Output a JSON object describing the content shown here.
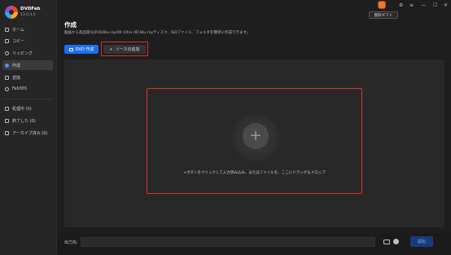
{
  "app": {
    "brand": "DVDFab",
    "version": "13.0.4.5"
  },
  "window": {
    "minimize": "—",
    "maximize": "☐",
    "close": "✕",
    "menu": "≡",
    "settings": "⚙"
  },
  "header": {
    "gift_label": "無料ギフト"
  },
  "sidebar": {
    "items": [
      {
        "label": "ホーム"
      },
      {
        "label": "コピー"
      },
      {
        "label": "リッピング"
      },
      {
        "label": "作成"
      },
      {
        "label": "変換"
      },
      {
        "label": "Fab365"
      }
    ],
    "queue": [
      {
        "label": "処理中 (0)"
      },
      {
        "label": "終了した (0)"
      },
      {
        "label": "アーカイブ済み (0)"
      }
    ]
  },
  "main": {
    "title": "作成",
    "description": "動画から高品質なDVD/Blu-ray/4K Ultra HD Blu-rayディスク、ISOファイル、フォルダを簡単に作成できます。",
    "dvd_button": "DVD 作成",
    "add_source_button": "ソースの追加",
    "add_source_icon": "+",
    "plus_symbol": "+",
    "drop_hint": "+ボタンをクリックして入力済み込み、またはファイルを、ここにドラッグ＆ドロップ"
  },
  "footer": {
    "output_label": "出力先:",
    "output_value": "",
    "start_button": "開始"
  },
  "colors": {
    "accent": "#1c6ef0",
    "highlight": "#e03131",
    "background": "#1e1e1e"
  }
}
